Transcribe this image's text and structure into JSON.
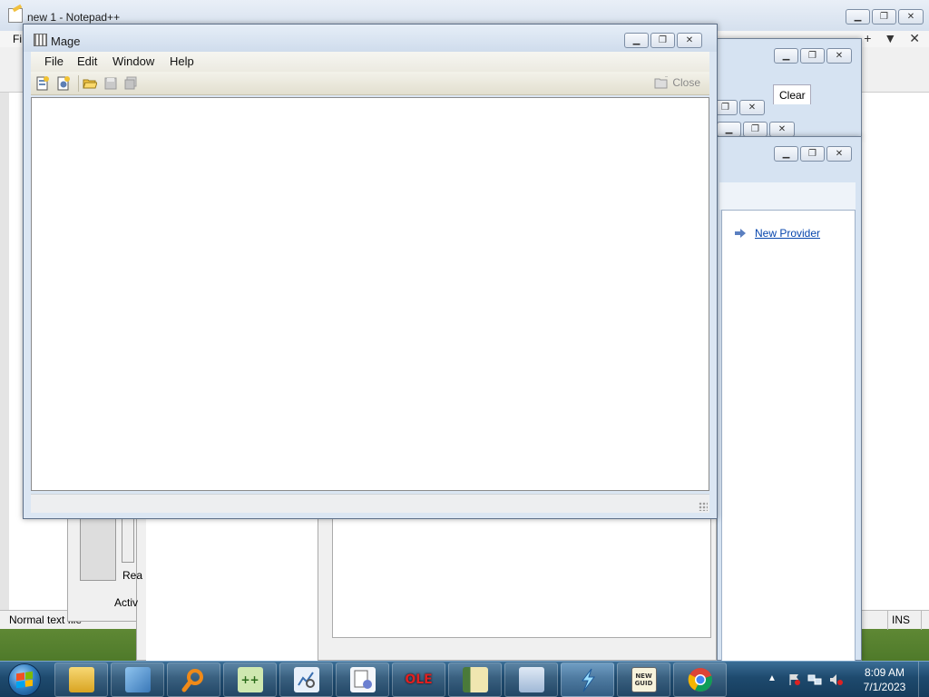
{
  "notepad": {
    "title": "new 1 - Notepad++",
    "menu_first": "Fi",
    "status_left": "Normal text file",
    "status_ins": "INS",
    "tab_plus": "+",
    "tab_down": "▼",
    "tab_close": "✕"
  },
  "background_windows": {
    "clear_tab": "Clear",
    "new_provider_link": "New Provider",
    "partial_rea": "Rea",
    "partial_acti": "Activ"
  },
  "mage": {
    "title": "Mage",
    "menu": [
      "File",
      "Edit",
      "Window",
      "Help"
    ],
    "toolbar_close_label": "Close",
    "controls": {
      "minimize": "▭",
      "maximize": "❐",
      "close": "✕"
    }
  },
  "taskbar": {
    "items": [
      {
        "name": "windows-explorer",
        "label": ""
      },
      {
        "name": "control-panel",
        "label": ""
      },
      {
        "name": "search-tool",
        "label": ""
      },
      {
        "name": "notepad-plus-plus",
        "label": ""
      },
      {
        "name": "performance-monitor",
        "label": ""
      },
      {
        "name": "properties-tool",
        "label": ""
      },
      {
        "name": "ole-viewer",
        "label": "OLE"
      },
      {
        "name": "registry-tool",
        "label": ""
      },
      {
        "name": "remote-desktop",
        "label": ""
      },
      {
        "name": "mage-tool",
        "label": ""
      },
      {
        "name": "guid-generator",
        "label": "NEW GUID"
      },
      {
        "name": "chrome",
        "label": ""
      }
    ],
    "clock_time": "8:09 AM",
    "clock_date": "7/1/2023"
  },
  "colors": {
    "taskbar": "#1e4a6e",
    "link": "#0645ad",
    "window_frame": "#dbe6f3"
  }
}
